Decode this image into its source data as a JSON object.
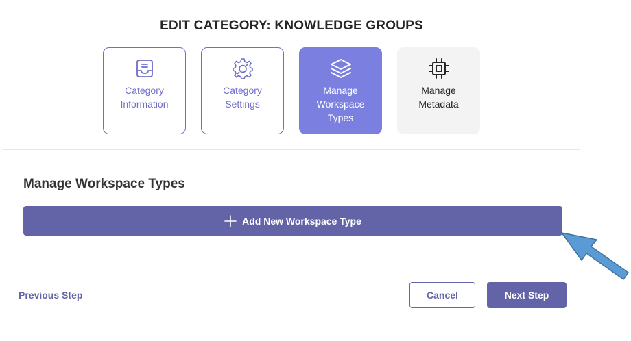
{
  "dialog": {
    "title": "EDIT CATEGORY: KNOWLEDGE GROUPS",
    "steps": [
      {
        "label": "Category\nInformation",
        "icon": "inbox-icon",
        "state": "completed"
      },
      {
        "label": "Category\nSettings",
        "icon": "settings-gear-icon",
        "state": "completed"
      },
      {
        "label": "Manage\nWorkspace\nTypes",
        "icon": "layers-icon",
        "state": "active"
      },
      {
        "label": "Manage\nMetadata",
        "icon": "chip-icon",
        "state": "pending"
      }
    ],
    "section_title": "Manage Workspace Types",
    "add_button_label": "Add New Workspace Type",
    "footer": {
      "previous_label": "Previous Step",
      "cancel_label": "Cancel",
      "next_label": "Next Step"
    }
  },
  "colors": {
    "primary": "#6264a7",
    "active_step": "#7b7fe0",
    "step_outline": "#6f6ec8",
    "pending_step_bg": "#f3f3f3",
    "annotation_arrow": "#5b9bd5"
  }
}
